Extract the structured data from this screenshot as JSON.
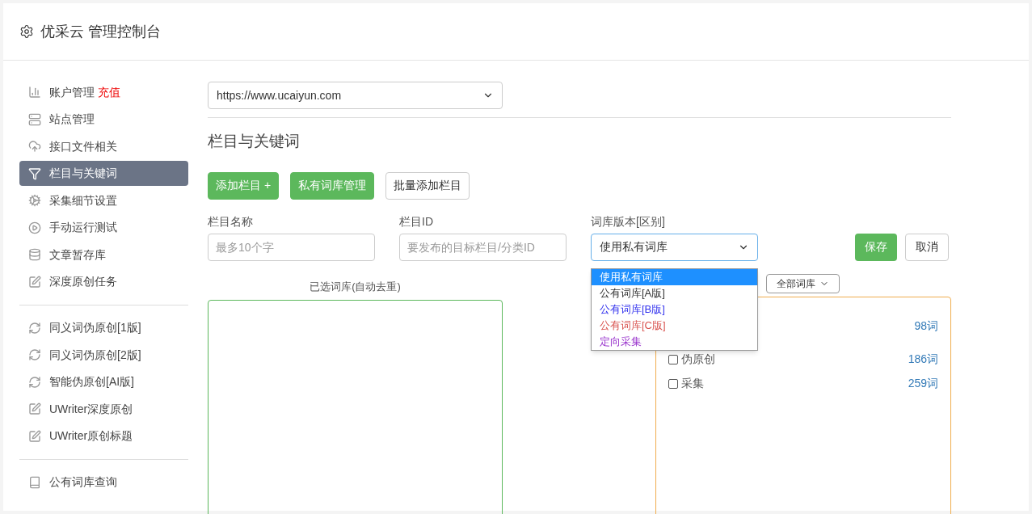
{
  "header": {
    "title": "优采云 管理控制台"
  },
  "sidebar": {
    "groups": [
      {
        "items": [
          {
            "label": "账户管理",
            "badge": "充值",
            "selected": false
          },
          {
            "label": "站点管理",
            "selected": false
          },
          {
            "label": "接口文件相关",
            "selected": false
          },
          {
            "label": "栏目与关键词",
            "selected": true
          },
          {
            "label": "采集细节设置",
            "selected": false
          },
          {
            "label": "手动运行测试",
            "selected": false
          },
          {
            "label": "文章暂存库",
            "selected": false
          },
          {
            "label": "深度原创任务",
            "selected": false
          }
        ]
      },
      {
        "items": [
          {
            "label": "同义词伪原创[1版]",
            "selected": false
          },
          {
            "label": "同义词伪原创[2版]",
            "selected": false
          },
          {
            "label": "智能伪原创[AI版]",
            "selected": false
          },
          {
            "label": "UWriter深度原创",
            "selected": false
          },
          {
            "label": "UWriter原创标题",
            "selected": false
          }
        ]
      },
      {
        "items": [
          {
            "label": "公有词库查询",
            "selected": false
          }
        ]
      }
    ]
  },
  "site_select": {
    "value": "https://www.ucaiyun.com"
  },
  "section_title": "栏目与关键词",
  "buttons": [
    {
      "label": "添加栏目 +",
      "kind": "primary"
    },
    {
      "label": "私有词库管理",
      "kind": "primary"
    },
    {
      "label": "批量添加栏目",
      "kind": "default"
    }
  ],
  "form": {
    "name_field": {
      "label": "栏目名称",
      "placeholder": "最多10个字"
    },
    "id_field": {
      "label": "栏目ID",
      "placeholder": "要发布的目标栏目/分类ID"
    },
    "version_select": {
      "label": "词库版本[区别]",
      "value": "使用私有词库",
      "expanded": true,
      "options": [
        {
          "label": "使用私有词库",
          "selected": true
        },
        {
          "label": "公有词库[A版]",
          "selected": false,
          "color": "#333333"
        },
        {
          "label": "公有词库[B版]",
          "selected": false,
          "color": "#3333ee"
        },
        {
          "label": "公有词库[C版]",
          "selected": false,
          "color": "#d9534f"
        },
        {
          "label": "定向采集",
          "selected": false,
          "color": "#9933cc"
        }
      ]
    },
    "save": "保存",
    "cancel": "取消"
  },
  "selected_panel": {
    "title": "已选词库(自动去重)"
  },
  "library_panel": {
    "filter": "全部词库",
    "rows": [
      {
        "count": "98词"
      },
      {
        "label": "伪原创",
        "count": "186词",
        "checked": false
      },
      {
        "label": "采集",
        "count": "259词",
        "checked": false
      }
    ]
  }
}
